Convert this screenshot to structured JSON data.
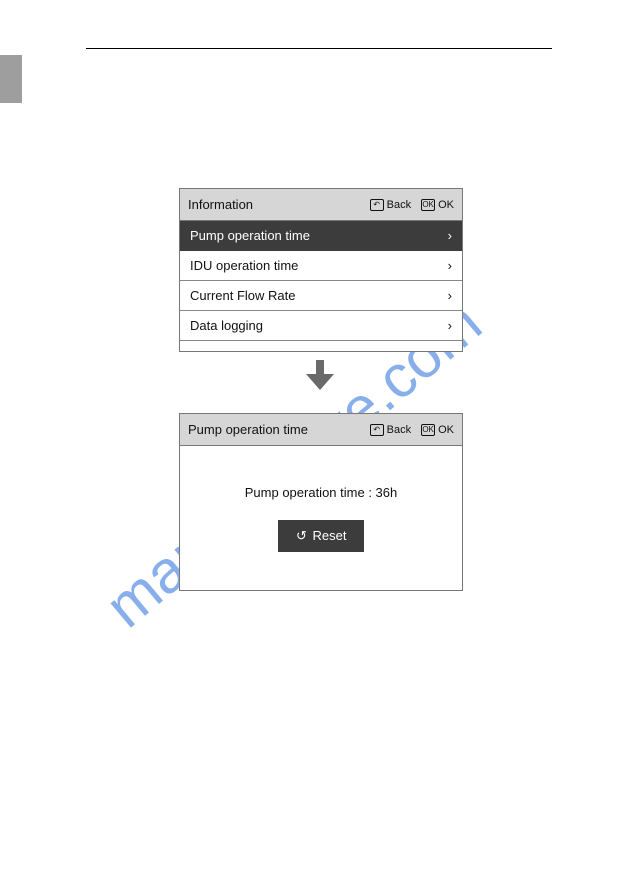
{
  "watermark": "manualshive.com",
  "panel1": {
    "title": "Information",
    "back": "Back",
    "ok": "OK",
    "items": [
      {
        "label": "Pump operation time",
        "selected": true
      },
      {
        "label": "IDU operation time",
        "selected": false
      },
      {
        "label": "Current Flow Rate",
        "selected": false
      },
      {
        "label": "Data logging",
        "selected": false
      }
    ]
  },
  "panel2": {
    "title": "Pump operation time",
    "back": "Back",
    "ok": "OK",
    "detail_text": "Pump operation time : 36h",
    "reset_label": "Reset"
  }
}
